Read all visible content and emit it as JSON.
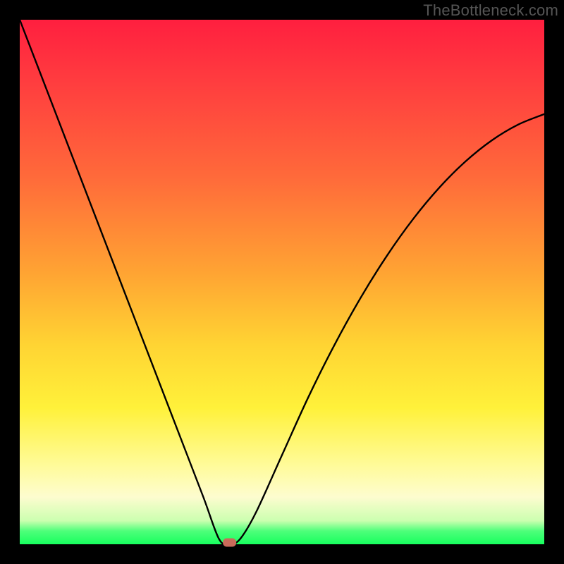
{
  "watermark": "TheBottleneck.com",
  "chart_data": {
    "type": "line",
    "title": "",
    "xlabel": "",
    "ylabel": "",
    "xlim": [
      0,
      100
    ],
    "ylim": [
      0,
      100
    ],
    "x": [
      0,
      5,
      10,
      15,
      20,
      25,
      30,
      35,
      38,
      40,
      42,
      45,
      50,
      55,
      60,
      65,
      70,
      75,
      80,
      85,
      90,
      95,
      100
    ],
    "y": [
      100,
      87,
      74,
      61,
      48,
      35,
      22,
      9,
      1,
      0,
      1,
      6,
      17,
      28,
      38,
      47,
      55,
      62,
      68,
      73,
      77,
      80,
      82
    ],
    "minimum": {
      "x": 40,
      "y": 0
    },
    "grid": false,
    "legend": null,
    "colors": {
      "curve": "#000000",
      "min_dot": "#c96a5a",
      "bg_top": "#ff1f3f",
      "bg_bottom": "#17ff5e"
    }
  }
}
